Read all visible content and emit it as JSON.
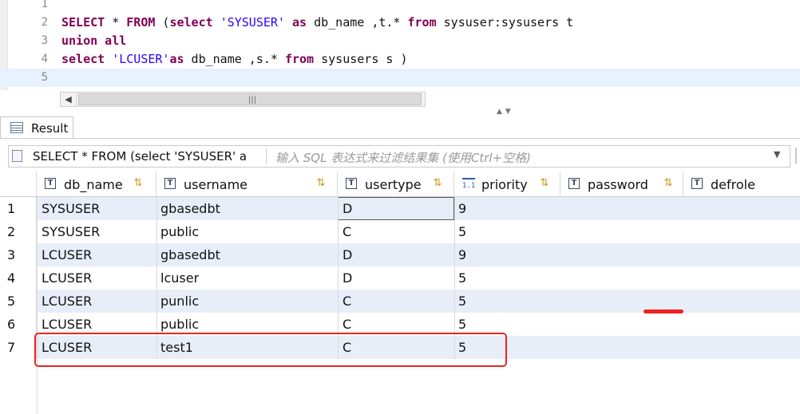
{
  "editor": {
    "lines": [
      {
        "num": "1"
      },
      {
        "num": "2"
      },
      {
        "num": "3"
      },
      {
        "num": "4"
      },
      {
        "num": "5"
      }
    ],
    "line2": {
      "kw_select": "SELECT",
      "t1": " * ",
      "kw_from": "FROM",
      "t2": " (",
      "kw_select2": "select",
      "t3": " ",
      "str_sysuser": "'SYSUSER'",
      "t4": " ",
      "kw_as": "as",
      "t5": " db_name ,t.* ",
      "kw_from2": "from",
      "t6": " sysuser:sysusers t"
    },
    "line3": {
      "kw_union": "union all"
    },
    "line4": {
      "kw_select": "select",
      "t1": " ",
      "str_lcuser": "'LCUSER'",
      "kw_as": "as",
      "t2": " db_name ,s.* ",
      "kw_from": "from",
      "t3": " sysusers s )"
    },
    "hscroll_grip": "|||",
    "sash_glyph": "▲▼"
  },
  "result_tab": {
    "label": "Result"
  },
  "filter_bar": {
    "query_text": "SELECT * FROM (select 'SYSUSER' a",
    "placeholder": "输入 SQL 表达式来过滤结果集 (使用Ctrl+空格)",
    "dropdown_glyph": "▼"
  },
  "grid": {
    "columns": [
      {
        "label": "db_name",
        "type_glyph": "T",
        "sort_glyph": "⇅"
      },
      {
        "label": "username",
        "type_glyph": "T",
        "sort_glyph": "⇅"
      },
      {
        "label": "usertype",
        "type_glyph": "T",
        "sort_glyph": "⇅"
      },
      {
        "label": "priority",
        "type_glyph": "1.1",
        "sort_glyph": "⇅"
      },
      {
        "label": "password",
        "type_glyph": "T",
        "sort_glyph": "⇅"
      },
      {
        "label": "defrole",
        "type_glyph": "T"
      }
    ],
    "rows": [
      {
        "n": "1",
        "db_name": "SYSUSER",
        "username": "gbasedbt",
        "usertype": "D",
        "priority": "9"
      },
      {
        "n": "2",
        "db_name": "SYSUSER",
        "username": "public",
        "usertype": "C",
        "priority": "5"
      },
      {
        "n": "3",
        "db_name": "LCUSER",
        "username": "gbasedbt",
        "usertype": "D",
        "priority": "9"
      },
      {
        "n": "4",
        "db_name": "LCUSER",
        "username": "lcuser",
        "usertype": "D",
        "priority": "5"
      },
      {
        "n": "5",
        "db_name": "LCUSER",
        "username": "punlic",
        "usertype": "C",
        "priority": "5"
      },
      {
        "n": "6",
        "db_name": "LCUSER",
        "username": "public",
        "usertype": "C",
        "priority": "5"
      },
      {
        "n": "7",
        "db_name": "LCUSER",
        "username": "test1",
        "usertype": "C",
        "priority": "5"
      }
    ]
  },
  "colors": {
    "keyword": "#7f0055",
    "string": "#2a00ff",
    "alt_row": "#e8eef8",
    "annotation_red": "#ee2222"
  }
}
